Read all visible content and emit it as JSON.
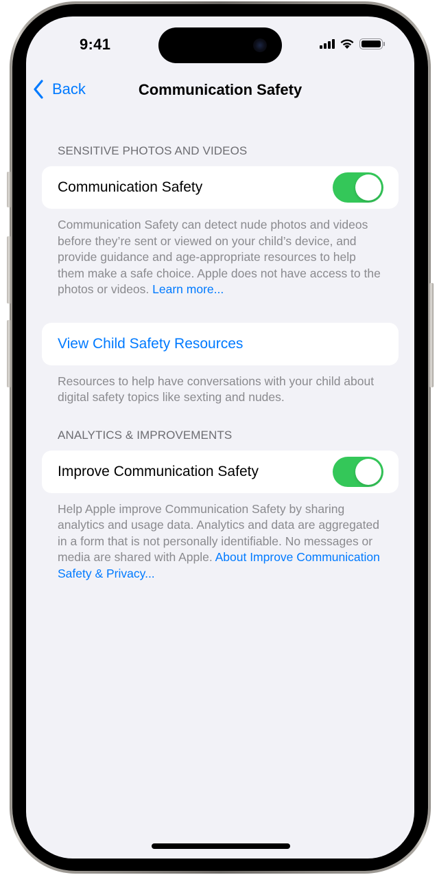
{
  "status_bar": {
    "time": "9:41",
    "icons": [
      "cellular-signal-icon",
      "wifi-icon",
      "battery-icon"
    ]
  },
  "nav": {
    "back_label": "Back",
    "back_icon": "chevron-left-icon",
    "title": "Communication Safety"
  },
  "sections": {
    "sensitive": {
      "header": "SENSITIVE PHOTOS AND VIDEOS",
      "toggle_label": "Communication Safety",
      "toggle_on": true,
      "footer_text": "Communication Safety can detect nude photos and videos before they’re sent or viewed on your child’s device, and provide guidance and age-appropriate resources to help them make a safe choice. Apple does not have access to the photos or videos. ",
      "footer_link": "Learn more..."
    },
    "resources": {
      "link_label": "View Child Safety Resources",
      "footer_text": "Resources to help have conversations with your child about digital safety topics like sexting and nudes."
    },
    "analytics": {
      "header": "ANALYTICS & IMPROVEMENTS",
      "toggle_label": "Improve Communication Safety",
      "toggle_on": true,
      "footer_text": "Help Apple improve Communication Safety by sharing analytics and usage data. Analytics and data are aggregated in a form that is not personally identifiable. No messages or media are shared with Apple. ",
      "footer_link": "About Improve Communication Safety & Privacy..."
    }
  },
  "colors": {
    "accent": "#007aff",
    "toggle_on": "#34c759",
    "background": "#f2f2f7",
    "secondary_text": "#8a8a8e"
  }
}
